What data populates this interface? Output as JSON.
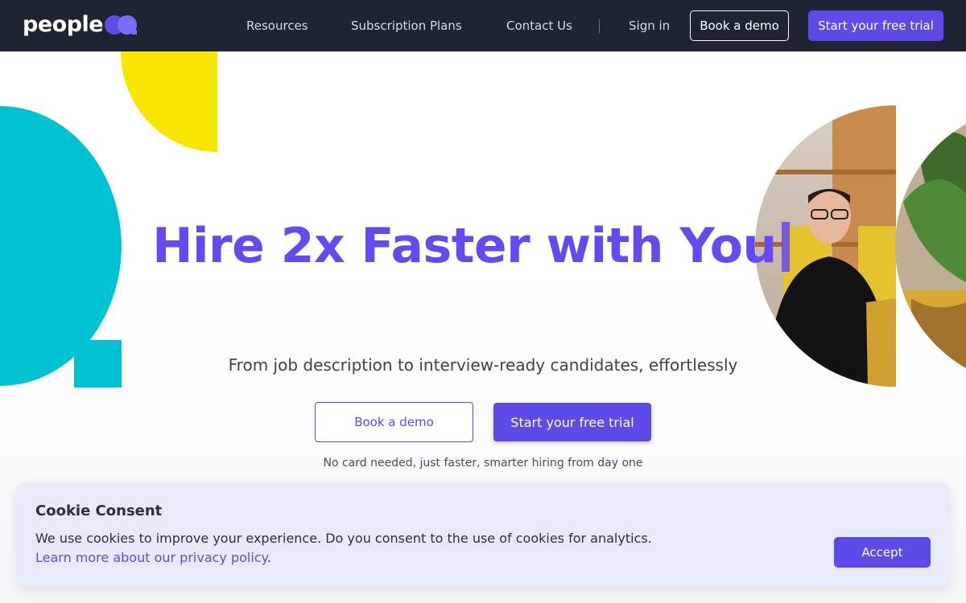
{
  "brand": {
    "name": "people",
    "accent": "#5b4ce8",
    "nav_bg": "#1f2433"
  },
  "nav": {
    "links": [
      "Resources",
      "Subscription Plans",
      "Contact Us"
    ],
    "sign_in": "Sign in",
    "book_demo": "Book a demo",
    "free_trial": "Start your free trial"
  },
  "hero": {
    "headline": "Hire 2x Faster with You",
    "subline": "From job description to interview-ready candidates, effortlessly",
    "book_demo": "Book a demo",
    "free_trial": "Start your free trial",
    "note": "No card needed, just faster, smarter hiring from day one",
    "headline_color": "#6649f0",
    "deco_colors": {
      "teal": "#00c2d1",
      "yellow": "#f7e600"
    }
  },
  "cookie": {
    "title": "Cookie Consent",
    "text": "We use cookies to improve your experience. Do you consent to the use of cookies for analytics.",
    "link": "Learn more about our privacy policy",
    "link_suffix": ".",
    "accept": "Accept"
  }
}
